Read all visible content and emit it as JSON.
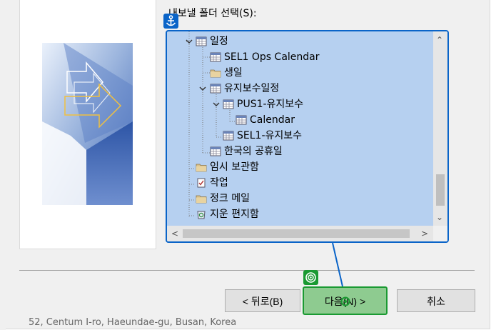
{
  "dialog": {
    "folder_select_label": "내보낼 폴더 선택(S):",
    "background_text": "52, Centum I-ro, Haeundae-gu, Busan, Korea"
  },
  "tree": {
    "items": [
      {
        "label": "일정",
        "icon": "calendar-icon",
        "expander": "expanded"
      },
      {
        "label": "SEL1 Ops Calendar",
        "icon": "calendar-icon"
      },
      {
        "label": "생일",
        "icon": "folder-icon"
      },
      {
        "label": "유지보수일정",
        "icon": "calendar-icon",
        "expander": "expanded"
      },
      {
        "label": "PUS1-유지보수",
        "icon": "calendar-icon",
        "expander": "expanded"
      },
      {
        "label": "Calendar",
        "icon": "calendar-icon"
      },
      {
        "label": "SEL1-유지보수",
        "icon": "calendar-icon"
      },
      {
        "label": "한국의 공휴일",
        "icon": "calendar-icon"
      },
      {
        "label": "임시 보관함",
        "icon": "folder-icon"
      },
      {
        "label": "작업",
        "icon": "task-icon"
      },
      {
        "label": "정크 메일",
        "icon": "folder-icon"
      },
      {
        "label": "지운 편지함",
        "icon": "recycle-icon"
      }
    ]
  },
  "buttons": {
    "back": "< 뒤로(B)",
    "next": "다음(N) >",
    "cancel": "취소"
  },
  "colors": {
    "accent_blue": "#0a64c8",
    "accent_green": "#1a9a32",
    "tree_selection": "#b6d0f0",
    "next_button_fill": "#8ecb90"
  },
  "annotations": {
    "anchor_badge_icon": "anchor-icon",
    "target_badge_icon": "target-icon"
  }
}
